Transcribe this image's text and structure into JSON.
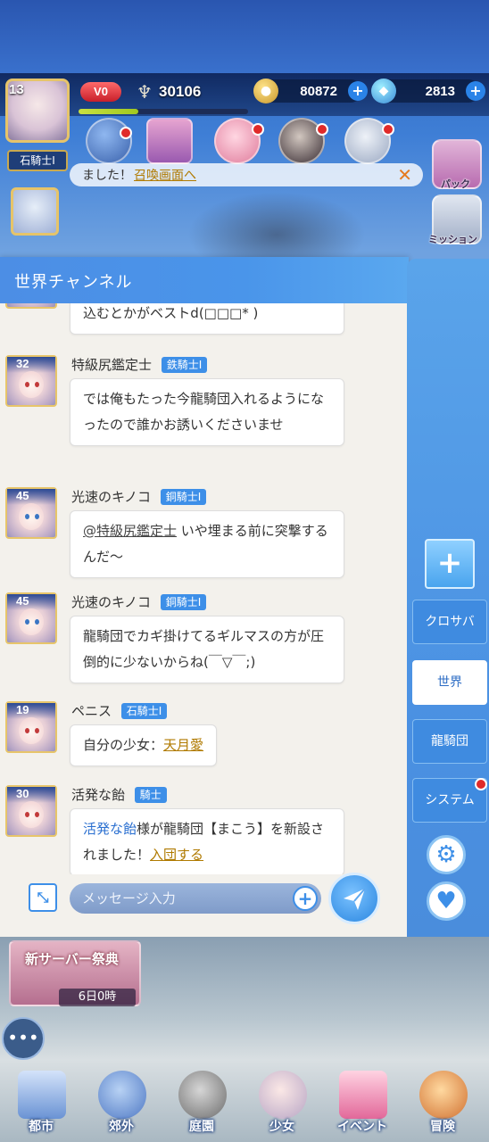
{
  "hud": {
    "player_level": "13",
    "rank": "石騎士I",
    "vip": "V0",
    "power": "30106",
    "power_progress_percent": 35,
    "gold": "80872",
    "gems": "2813"
  },
  "top_icons": {
    "right_labels": [
      "パック",
      "ミッション"
    ]
  },
  "notice": {
    "text": "ました！",
    "link": "召喚画面へ"
  },
  "chat": {
    "title": "世界チャンネル",
    "messages": [
      {
        "name": "",
        "badge": "",
        "level": "",
        "text": "込むとかがベストd(□□□* )"
      },
      {
        "name": "特級尻鑑定士",
        "badge": "鉄騎士I",
        "level": "32",
        "text": "では俺もたった今龍騎団入れるようになったので誰かお誘いくださいませ"
      },
      {
        "name": "光速のキノコ",
        "badge": "銅騎士I",
        "level": "45",
        "mention": "@特級尻鑑定士",
        "text": "いや埋まる前に突撃するんだ～"
      },
      {
        "name": "光速のキノコ",
        "badge": "銅騎士I",
        "level": "45",
        "text": "龍騎団でカギ掛けてるギルマスの方が圧倒的に少ないからね(￣▽￣;)"
      },
      {
        "name": "ペニス",
        "badge": "石騎士I",
        "level": "19",
        "text_prefix": "自分の少女：",
        "link": "天月愛"
      },
      {
        "name": "活発な飴",
        "badge": "騎士",
        "level": "30",
        "highlight_name": "活発な飴",
        "text": "様が龍騎団【まこう】を新設されました！",
        "link": "入団する"
      }
    ],
    "input_placeholder": "メッセージ入力"
  },
  "channels": {
    "add_label": "+",
    "tabs": [
      "クロサバ",
      "世界",
      "龍騎団",
      "システム"
    ],
    "active": "世界"
  },
  "event": {
    "title": "新サーバー祭典",
    "timer": "6日0時"
  },
  "bottom_nav": [
    "都市",
    "郊外",
    "庭園",
    "少女",
    "イベント",
    "冒険"
  ],
  "colors": {
    "accent": "#3d8fe8",
    "link_gold": "#b07a00",
    "header_blue": "#4a95ea",
    "badge_blue": "#3d8fe8",
    "notification_red": "#e02a2a"
  }
}
